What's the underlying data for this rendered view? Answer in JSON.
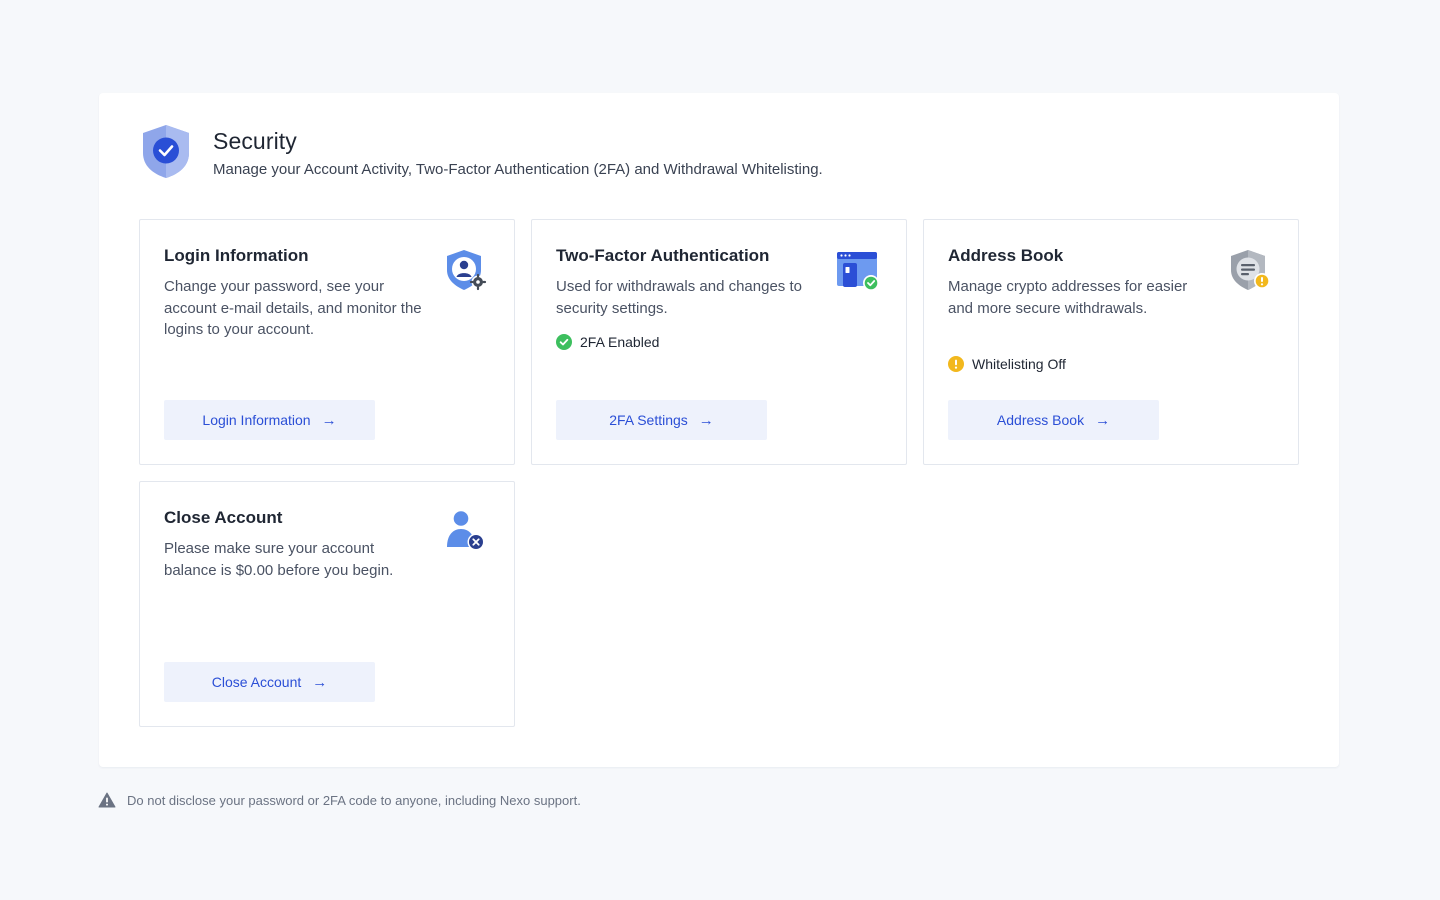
{
  "header": {
    "title": "Security",
    "subtitle": "Manage your Account Activity, Two-Factor Authentication (2FA) and Withdrawal Whitelisting."
  },
  "cards": {
    "login": {
      "title": "Login Information",
      "description": "Change your password, see your account e-mail details, and monitor the logins to your account.",
      "button": "Login Information",
      "icon": "user-shield-gear-icon"
    },
    "twofa": {
      "title": "Two-Factor Authentication",
      "description": "Used for withdrawals and changes to security settings.",
      "status": "2FA Enabled",
      "status_icon": "check-circle-icon",
      "button": "2FA Settings",
      "icon": "phone-window-check-icon"
    },
    "address_book": {
      "title": "Address Book",
      "description": "Manage crypto addresses for easier and more secure withdrawals.",
      "status": "Whitelisting Off",
      "status_icon": "warning-circle-icon",
      "button": "Address Book",
      "icon": "shield-list-warning-icon"
    },
    "close": {
      "title": "Close Account",
      "description": "Please make sure your account balance is $0.00 before you begin.",
      "button": "Close Account",
      "icon": "user-remove-icon"
    }
  },
  "footer": {
    "note": "Do not disclose your password or 2FA code to anyone, including Nexo support."
  },
  "colors": {
    "accent": "#2b4fd6",
    "button_bg": "#eef2fc",
    "success": "#3dbf5e",
    "warning": "#f2b81d",
    "page_bg": "#f6f8fb"
  }
}
